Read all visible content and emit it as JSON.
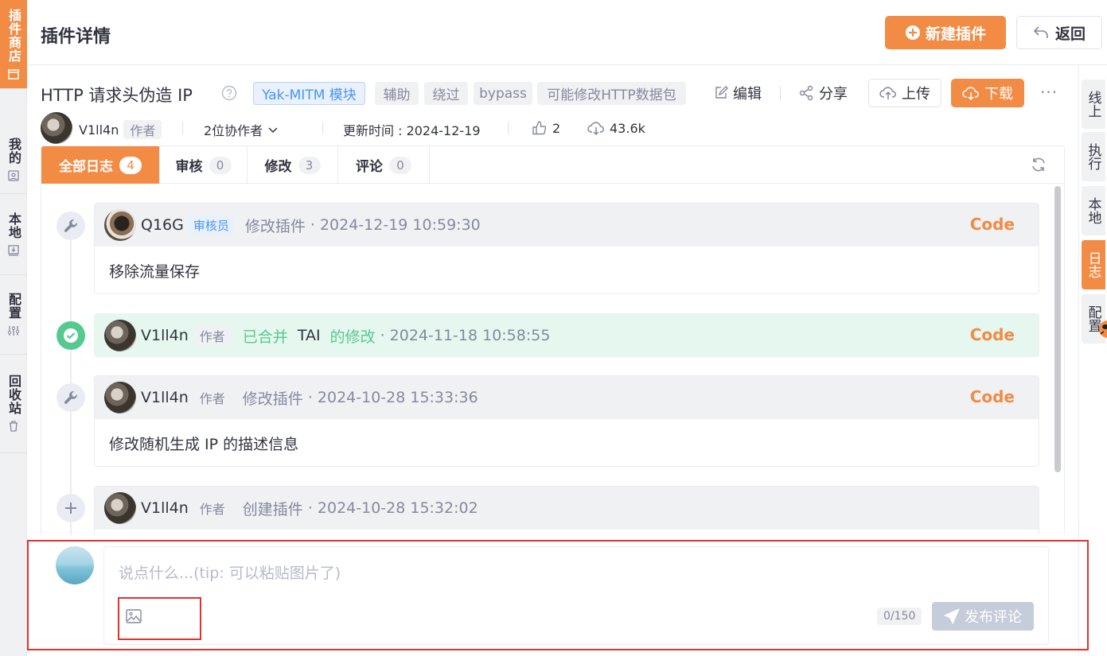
{
  "left_nav": {
    "items": [
      {
        "label": "插件商店",
        "icon": "store-icon",
        "active": true
      },
      {
        "label": "我的",
        "icon": "user-icon",
        "active": false
      },
      {
        "label": "本地",
        "icon": "local-download-icon",
        "active": false
      },
      {
        "label": "配置",
        "icon": "settings-sliders-icon",
        "active": false
      },
      {
        "label": "回收站",
        "icon": "trash-icon",
        "active": false
      }
    ]
  },
  "header": {
    "title": "插件详情",
    "new_plugin_label": "新建插件",
    "back_label": "返回"
  },
  "plugin": {
    "name": "HTTP 请求头伪造 IP",
    "type_tag": "Yak-MITM 模块",
    "tags": [
      "辅助",
      "绕过",
      "bypass",
      "可能修改HTTP数据包"
    ],
    "edit_label": "编辑",
    "share_label": "分享",
    "upload_label": "上传",
    "download_label": "下载",
    "more_label": "···",
    "author": "V1ll4n",
    "author_tag": "作者",
    "collaborators": "2位协作者",
    "updated": "更新时间 : 2024-12-19",
    "likes": "2",
    "downloads": "43.6k"
  },
  "right_nav": {
    "tabs": [
      {
        "label": "线上",
        "active": false
      },
      {
        "label": "执行",
        "active": false
      },
      {
        "label": "本地",
        "active": false
      },
      {
        "label": "日志",
        "active": true
      },
      {
        "label": "配置",
        "active": false
      }
    ]
  },
  "log_tabs": [
    {
      "label": "全部日志",
      "count": "4",
      "active": true
    },
    {
      "label": "审核",
      "count": "0",
      "active": false
    },
    {
      "label": "修改",
      "count": "3",
      "active": false
    },
    {
      "label": "评论",
      "count": "0",
      "active": false
    }
  ],
  "logs": [
    {
      "icon": "wrench-icon",
      "user": "Q16G",
      "role": "审核员",
      "action": "修改插件",
      "time": "· 2024-12-19 10:59:30",
      "code": "Code",
      "body": "移除流量保存"
    },
    {
      "icon": "check-circle-icon",
      "user": "V1ll4n",
      "role": "作者",
      "merged": "已合并",
      "target": "TAI",
      "merged_suffix": "的修改",
      "time": "· 2024-11-18 10:58:55",
      "code": "Code"
    },
    {
      "icon": "wrench-icon",
      "user": "V1ll4n",
      "role": "作者",
      "action": "修改插件",
      "time": "· 2024-10-28 15:33:36",
      "code": "Code",
      "body": "修改随机生成 IP 的描述信息"
    },
    {
      "icon": "plus-icon",
      "user": "V1ll4n",
      "role": "作者",
      "action": "创建插件",
      "time": "· 2024-10-28 15:32:02"
    }
  ],
  "comment": {
    "placeholder": "说点什么...(tip: 可以粘贴图片了)",
    "value": "",
    "counter": "0/150",
    "publish_label": "发布评论"
  },
  "colors": {
    "accent": "#f28b44",
    "merged_green": "#56c991",
    "blue_tag": "#4a94f8",
    "highlight_red": "#e4322b"
  }
}
